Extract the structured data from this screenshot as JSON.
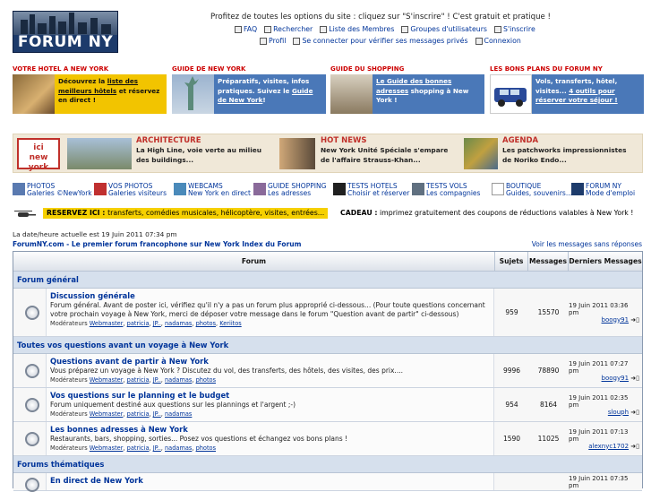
{
  "logo": {
    "text": "FORUM NY"
  },
  "promo": "Profitez de toutes les options du site : cliquez sur \"S'inscrire\" ! C'est gratuit et pratique !",
  "nav_row1": [
    "FAQ",
    "Rechercher",
    "Liste des Membres",
    "Groupes d'utilisateurs",
    "S'inscrire"
  ],
  "nav_row2": [
    "Profil",
    "Se connecter pour vérifier ses messages privés",
    "Connexion"
  ],
  "sections": [
    "VOTRE HOTEL A NEW YORK",
    "GUIDE DE NEW YORK",
    "GUIDE DU SHOPPING",
    "LES BONS PLANS DU FORUM NY"
  ],
  "banners": [
    {
      "pre": "Découvrez la ",
      "link": "liste des meilleurs hôtels",
      "post": " et réservez en direct !",
      "color": "#f2c400"
    },
    {
      "pre": "Préparatifs, visites, infos pratiques. Suivez le ",
      "link": "Guide de New York",
      "post": "!",
      "color": "#4a78b8"
    },
    {
      "pre": "",
      "link": "Le Guide des bonnes adresses",
      "post": " shopping à New York !",
      "color": "#4a78b8"
    },
    {
      "pre": "Vols, transferts, hôtel, visites... ",
      "link": "4 outils pour réserver votre séjour !",
      "post": "",
      "color": "#4a78b8"
    }
  ],
  "hot": [
    {
      "title": "ARCHITECTURE",
      "body": "La High Line, voie verte au milieu des buildings..."
    },
    {
      "title": "HOT NEWS",
      "body": "New York Unité Spéciale s'empare de l'affaire Strauss-Khan..."
    },
    {
      "title": "AGENDA",
      "body": "Les patchworks impressionnistes de Noriko Endo..."
    }
  ],
  "links": [
    {
      "a": "PHOTOS",
      "b": "Galeries ©NewYork"
    },
    {
      "a": "VOS PHOTOS",
      "b": "Galeries visiteurs"
    },
    {
      "a": "WEBCAMS",
      "b": "New York en direct"
    },
    {
      "a": "GUIDE SHOPPING",
      "b": "Les adresses"
    },
    {
      "a": "TESTS HOTELS",
      "b": "Choisir et réserver"
    },
    {
      "a": "TESTS VOLS",
      "b": "Les compagnies"
    },
    {
      "a": "BOUTIQUE",
      "b": "Guides, souvenirs..."
    },
    {
      "a": "FORUM NY",
      "b": "Mode d'emploi"
    }
  ],
  "reserve": {
    "label": "RESERVEZ ICI :",
    "text": "transferts, comédies musicales, hélicoptère, visites, entrées...",
    "cadeau_label": "CADEAU :",
    "cadeau_text": "imprimez gratuitement des coupons de réductions valables à New York !"
  },
  "date": "La date/heure actuelle est 19 Juin 2011 07:34 pm",
  "site_name": "ForumNY.com - Le premier forum francophone sur New York Index du Forum",
  "view_all": "Voir les messages sans réponses",
  "table": {
    "headers": [
      "Forum",
      "Sujets",
      "Messages",
      "Derniers Messages"
    ],
    "categories": [
      "Forum général",
      "Toutes vos questions avant un voyage à New York",
      "Forums thématiques"
    ],
    "mods_label": "Modérateurs",
    "forums": [
      {
        "name": "Discussion générale",
        "desc": "Forum général. Avant de poster ici, vérifiez qu'il n'y a pas un forum plus approprié ci-dessous... (Pour toute questions concernant votre prochain voyage à New York, merci de déposer votre message dans le forum \"Question avant de partir\" ci-dessous)",
        "mods": [
          "Webmaster",
          "patricia",
          "JP..",
          "nadamas",
          "photos",
          "Keriitos"
        ],
        "topics": "959",
        "posts": "15570",
        "last_date": "19 Juin 2011 03:36 pm",
        "last_user": "boogy91"
      },
      {
        "name": "Questions avant de partir à New York",
        "desc": "Vous préparez un voyage à New York ? Discutez du vol, des transferts, des hôtels, des visites, des prix....",
        "mods": [
          "Webmaster",
          "patricia",
          "JP..",
          "nadamas",
          "photos"
        ],
        "topics": "9996",
        "posts": "78890",
        "last_date": "19 Juin 2011 07:27 pm",
        "last_user": "boogy91"
      },
      {
        "name": "Vos questions sur le planning et le budget",
        "desc": "Forum uniquement destiné aux questions sur les plannings et l'argent ;-)",
        "mods": [
          "Webmaster",
          "patricia",
          "JP..",
          "nadamas"
        ],
        "topics": "954",
        "posts": "8164",
        "last_date": "19 Juin 2011 02:35 pm",
        "last_user": "slouph"
      },
      {
        "name": "Les bonnes adresses à New York",
        "desc": "Restaurants, bars, shopping, sorties... Posez vos questions et échangez vos bons plans !",
        "mods": [
          "Webmaster",
          "patricia",
          "JP..",
          "nadamas",
          "photos"
        ],
        "topics": "1590",
        "posts": "11025",
        "last_date": "19 Juin 2011 07:13 pm",
        "last_user": "alexnyc1702"
      },
      {
        "name": "En direct de New York",
        "last_date": "19 Juin 2011 07:35 pm"
      }
    ]
  }
}
